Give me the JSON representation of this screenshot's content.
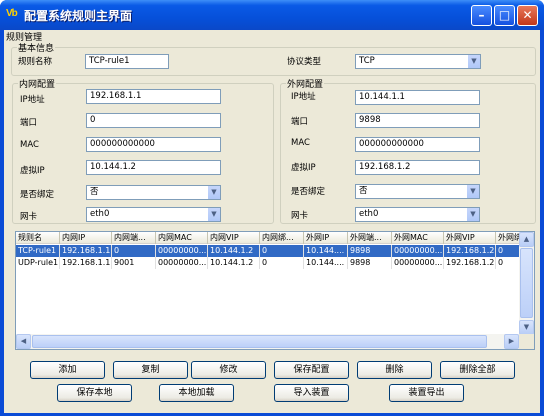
{
  "window": {
    "title": "配置系统规则主界面",
    "icon_text": "Vb",
    "controls": [
      "minimize-icon",
      "maximize-icon",
      "close-icon"
    ]
  },
  "menu": {
    "items": [
      "规则管理"
    ]
  },
  "basic": {
    "group_title": "基本信息",
    "rule_name_label": "规则名称",
    "rule_name": "TCP-rule1",
    "protocol_label": "协议类型",
    "protocol": "TCP"
  },
  "inner": {
    "group_title": "内网配置",
    "ip_label": "IP地址",
    "ip": "192.168.1.1",
    "port_label": "端口",
    "port": "0",
    "mac_label": "MAC",
    "mac": "000000000000",
    "vip_label": "虚拟IP",
    "vip": "10.144.1.2",
    "bind_label": "是否绑定",
    "bind": "否",
    "nic_label": "网卡",
    "nic": "eth0"
  },
  "outer": {
    "group_title": "外网配置",
    "ip_label": "IP地址",
    "ip": "10.144.1.1",
    "port_label": "端口",
    "port": "9898",
    "mac_label": "MAC",
    "mac": "000000000000",
    "vip_label": "虚拟IP",
    "vip": "192.168.1.2",
    "bind_label": "是否绑定",
    "bind": "否",
    "nic_label": "网卡",
    "nic": "eth0"
  },
  "table": {
    "headers": [
      "规则名",
      "内网IP",
      "内网端...",
      "内网MAC",
      "内网VIP",
      "内网绑...",
      "外网IP",
      "外网端...",
      "外网MAC",
      "外网VIP",
      "外网绑..."
    ],
    "rows": [
      [
        "TCP-rule1",
        "192.168.1.1",
        "0",
        "00000000...",
        "10.144.1.2",
        "0",
        "10.144....",
        "9898",
        "00000000...",
        "192.168.1.2",
        "0"
      ],
      [
        "UDP-rule1",
        "192.168.1.1",
        "9001",
        "00000000...",
        "10.144.1.2",
        "0",
        "10.144....",
        "9898",
        "00000000...",
        "192.168.1.2",
        "0"
      ]
    ],
    "selected_row": 0
  },
  "buttons": {
    "add": "添加",
    "copy": "复制",
    "modify": "修改",
    "save_config": "保存配置",
    "delete": "删除",
    "delete_all": "删除全部",
    "save_local": "保存本地",
    "load_local": "本地加载",
    "import": "导入装置",
    "export": "装置导出"
  },
  "colors": {
    "title_bar": "#0a5ae6",
    "window_bg": "#ece9d8",
    "selection": "#316ac5",
    "border": "#7f9db9"
  }
}
